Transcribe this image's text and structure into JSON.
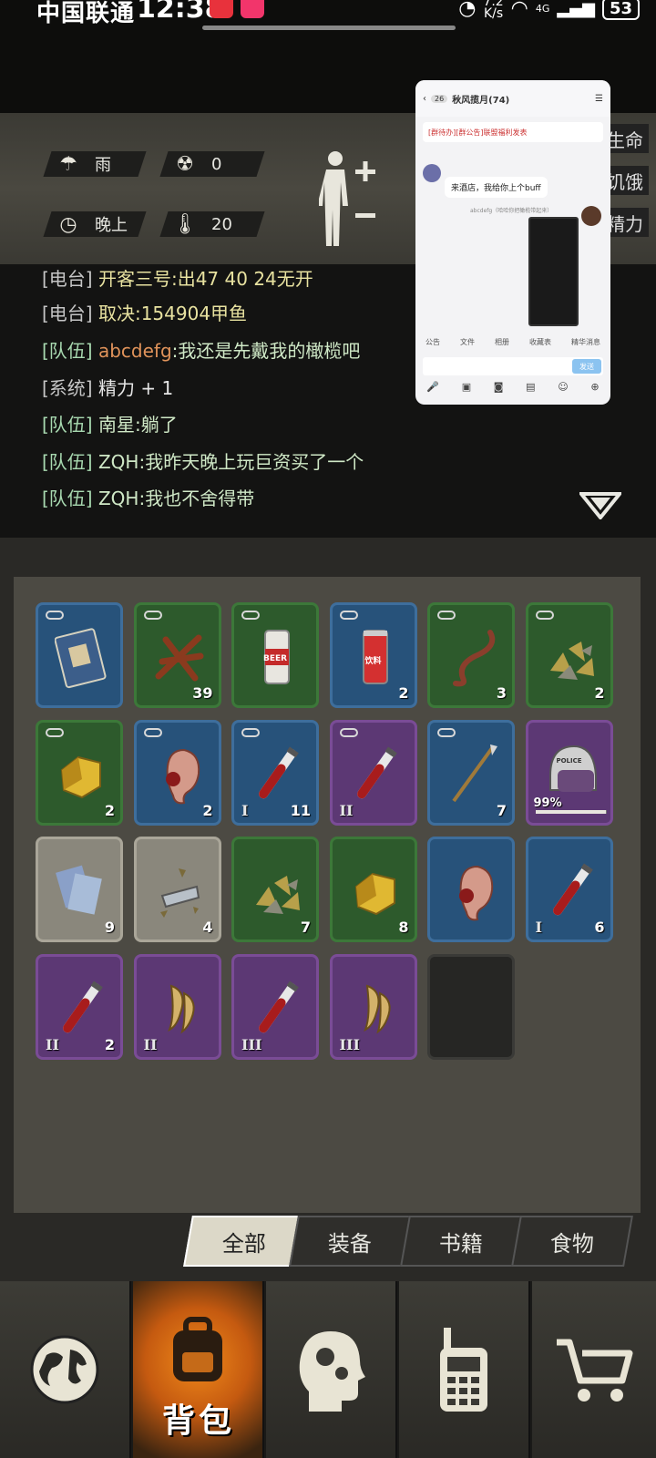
{
  "status_bar": {
    "carrier": "中国联通",
    "time": "12:38",
    "net_speed_value": "7.2",
    "net_speed_unit": "K/s",
    "signal_label": "4G",
    "battery": "53"
  },
  "hud": {
    "weather": "雨",
    "radiation": "0",
    "time_of_day": "晚上",
    "temperature": "20",
    "side_labels": [
      "生命",
      "饥饿",
      "精力"
    ]
  },
  "chat": {
    "lines": [
      {
        "channel": "[电台]",
        "name": "",
        "text": "开客三号:出47 40 24无开"
      },
      {
        "channel": "[电台]",
        "name": "",
        "text": "取决:154904甲鱼"
      },
      {
        "channel": "[队伍]",
        "name": "abcdefg",
        "text": ":我还是先戴我的橄榄吧"
      },
      {
        "channel": "[系统]",
        "name": "",
        "text": "精力 + 1"
      },
      {
        "channel": "[队伍]",
        "name": "",
        "text": "南星:躺了"
      },
      {
        "channel": "[队伍]",
        "name": "",
        "text": "ZQH:我昨天晚上玩巨资买了一个"
      },
      {
        "channel": "[队伍]",
        "name": "",
        "text": "ZQH:我也不舍得带"
      }
    ]
  },
  "mini_window": {
    "group_count": "26",
    "title": "秋风揽月(74)",
    "banner": "[群待办][群公告]联盟福利发表",
    "msg_left": "来酒店，我给你上个buff",
    "msg_right_name": "abcdefg（哈哈你把橄榄带起来）",
    "toolbar": [
      "公告",
      "文件",
      "相册",
      "收藏表",
      "精华消息"
    ],
    "send": "发送"
  },
  "inventory": {
    "items": [
      {
        "rarity": "blue",
        "icon": "book-icon",
        "count": "",
        "tier": "",
        "linked": true
      },
      {
        "rarity": "green",
        "icon": "wood-icon",
        "count": "39",
        "tier": "",
        "linked": true
      },
      {
        "rarity": "green",
        "icon": "beer-can-icon",
        "count": "",
        "tier": "",
        "linked": true,
        "label": "BEER"
      },
      {
        "rarity": "blue",
        "icon": "soda-can-icon",
        "count": "2",
        "tier": "",
        "linked": true,
        "label": "饮料"
      },
      {
        "rarity": "green",
        "icon": "worm-icon",
        "count": "3",
        "tier": "",
        "linked": true
      },
      {
        "rarity": "green",
        "icon": "scrap-pile-icon",
        "count": "2",
        "tier": "",
        "linked": true
      },
      {
        "rarity": "green",
        "icon": "gold-ore-icon",
        "count": "2",
        "tier": "",
        "linked": true
      },
      {
        "rarity": "blue",
        "icon": "ear-icon",
        "count": "2",
        "tier": "",
        "linked": true
      },
      {
        "rarity": "blue",
        "icon": "blood-vial-icon",
        "count": "11",
        "tier": "I",
        "linked": true
      },
      {
        "rarity": "purple",
        "icon": "blood-vial-icon",
        "count": "",
        "tier": "II",
        "linked": true
      },
      {
        "rarity": "blue",
        "icon": "spear-icon",
        "count": "7",
        "tier": "",
        "linked": true
      },
      {
        "rarity": "purple",
        "icon": "police-helmet-icon",
        "count": "",
        "tier": "",
        "linked": false,
        "durability": "99%",
        "durability_value": 0.99,
        "label": "POLICE"
      },
      {
        "rarity": "gray",
        "icon": "paper-icon",
        "count": "9",
        "tier": "",
        "linked": false
      },
      {
        "rarity": "gray",
        "icon": "metal-scrap-icon",
        "count": "4",
        "tier": "",
        "linked": false
      },
      {
        "rarity": "green",
        "icon": "scrap-pile-icon",
        "count": "7",
        "tier": "",
        "linked": false
      },
      {
        "rarity": "green",
        "icon": "gold-ore-icon",
        "count": "8",
        "tier": "",
        "linked": false
      },
      {
        "rarity": "blue",
        "icon": "ear-icon",
        "count": "",
        "tier": "",
        "linked": false
      },
      {
        "rarity": "blue",
        "icon": "blood-vial-icon",
        "count": "6",
        "tier": "I",
        "linked": false
      },
      {
        "rarity": "purple",
        "icon": "blood-vial-icon",
        "count": "2",
        "tier": "II",
        "linked": false
      },
      {
        "rarity": "purple",
        "icon": "claw-icon",
        "count": "",
        "tier": "II",
        "linked": false
      },
      {
        "rarity": "purple",
        "icon": "blood-vial-icon",
        "count": "",
        "tier": "III",
        "linked": false
      },
      {
        "rarity": "purple",
        "icon": "claw-icon",
        "count": "",
        "tier": "III",
        "linked": false
      },
      {
        "rarity": "empty",
        "icon": "",
        "count": "",
        "tier": "",
        "linked": false
      }
    ]
  },
  "tabs": [
    "全部",
    "装备",
    "书籍",
    "食物"
  ],
  "nav": {
    "items": [
      {
        "icon": "globe-icon",
        "label": ""
      },
      {
        "icon": "backpack-icon",
        "label": "背包"
      },
      {
        "icon": "head-gears-icon",
        "label": ""
      },
      {
        "icon": "radio-icon",
        "label": ""
      },
      {
        "icon": "cart-icon",
        "label": ""
      }
    ]
  },
  "colors": {
    "rarity_blue": "#27527a",
    "rarity_green": "#2d5a2c",
    "rarity_purple": "#5c3874",
    "rarity_gray": "#8a877c",
    "active_nav": "#f08a1a"
  }
}
